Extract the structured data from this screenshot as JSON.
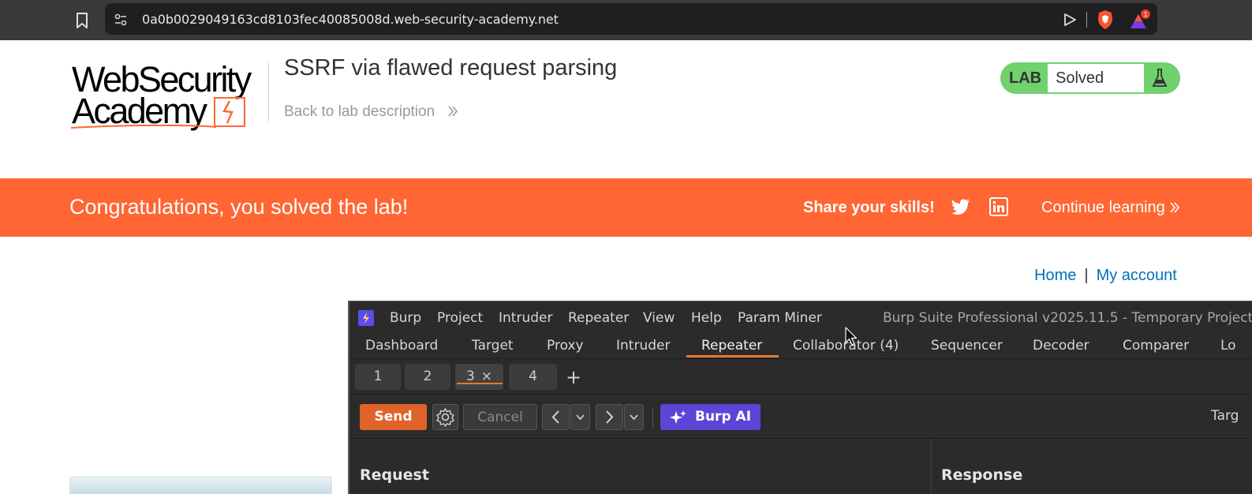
{
  "browser": {
    "url": "0a0b0029049163cd8103fec40085008d.web-security-academy.net"
  },
  "header": {
    "logo_line1": "WebSecurity",
    "logo_line2": "Academy",
    "lab_title": "SSRF via flawed request parsing",
    "back_link": "Back to lab description",
    "lab_badge_label": "LAB",
    "lab_status": "Solved"
  },
  "banner": {
    "message": "Congratulations, you solved the lab!",
    "share_text": "Share your skills!",
    "continue_text": "Continue learning",
    "color": "#ff6633"
  },
  "nav": {
    "home": "Home",
    "separator": "|",
    "my_account": "My account"
  },
  "burp": {
    "menus": [
      "Burp",
      "Project",
      "Intruder",
      "Repeater",
      "View",
      "Help",
      "Param Miner"
    ],
    "window_title": "Burp Suite Professional v2025.11.5 - Temporary Project",
    "tabs": [
      "Dashboard",
      "Target",
      "Proxy",
      "Intruder",
      "Repeater",
      "Collaborator (4)",
      "Sequencer",
      "Decoder",
      "Comparer",
      "Lo"
    ],
    "active_tab": "Repeater",
    "repeater_tabs": [
      "1",
      "2",
      "3",
      "4"
    ],
    "active_repeater_tab": "3",
    "close_glyph": "×",
    "add_tab_glyph": "+",
    "send_label": "Send",
    "cancel_label": "Cancel",
    "ai_label": "Burp AI",
    "target_label": "Targ",
    "request_title": "Request",
    "response_title": "Response",
    "accent": "#e8792b"
  }
}
